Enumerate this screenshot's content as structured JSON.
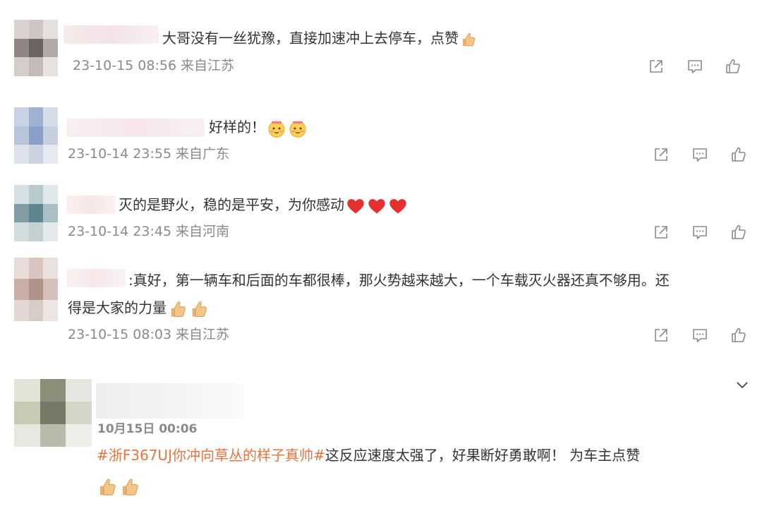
{
  "comments": [
    {
      "text": "大哥没有一丝犹豫，直接加速冲上去停车，点赞",
      "timestamp": "23-10-15 08:56",
      "location": "来自江苏",
      "emojis": [
        "thumbs-up"
      ]
    },
    {
      "text": "好样的！",
      "timestamp": "23-10-14 23:55",
      "location": "来自广东",
      "emojis": [
        "blush-face",
        "blush-face"
      ]
    },
    {
      "text": "灭的是野火，稳的是平安，为你感动",
      "timestamp": "23-10-14 23:45",
      "location": "来自河南",
      "emojis": [
        "heart",
        "heart",
        "heart"
      ]
    },
    {
      "text_line1": ":真好，第一辆车和后面的车都很棒，那火势越来越大，一个车载灭火器还真不够用。还",
      "text_line2": "得是大家的力量",
      "timestamp": "23-10-15 08:03",
      "location": "来自江苏",
      "emojis": [
        "thumbs-up",
        "thumbs-up"
      ]
    }
  ],
  "featured_comment": {
    "date": "10月15日 00:06",
    "topic": "#浙F367UJ你冲向草丛的样子真帅#",
    "text": "这反应速度太强了，好果断好勇敢啊！ 为车主点赞",
    "emojis": [
      "thumbs-up",
      "thumbs-up"
    ]
  },
  "icons": [
    "share-icon",
    "comment-icon",
    "like-icon",
    "chevron-down-icon"
  ],
  "colors": {
    "text": "#333333",
    "meta": "#8a8a8a",
    "topic": "#eb7340",
    "icon": "#8a8a8a"
  }
}
